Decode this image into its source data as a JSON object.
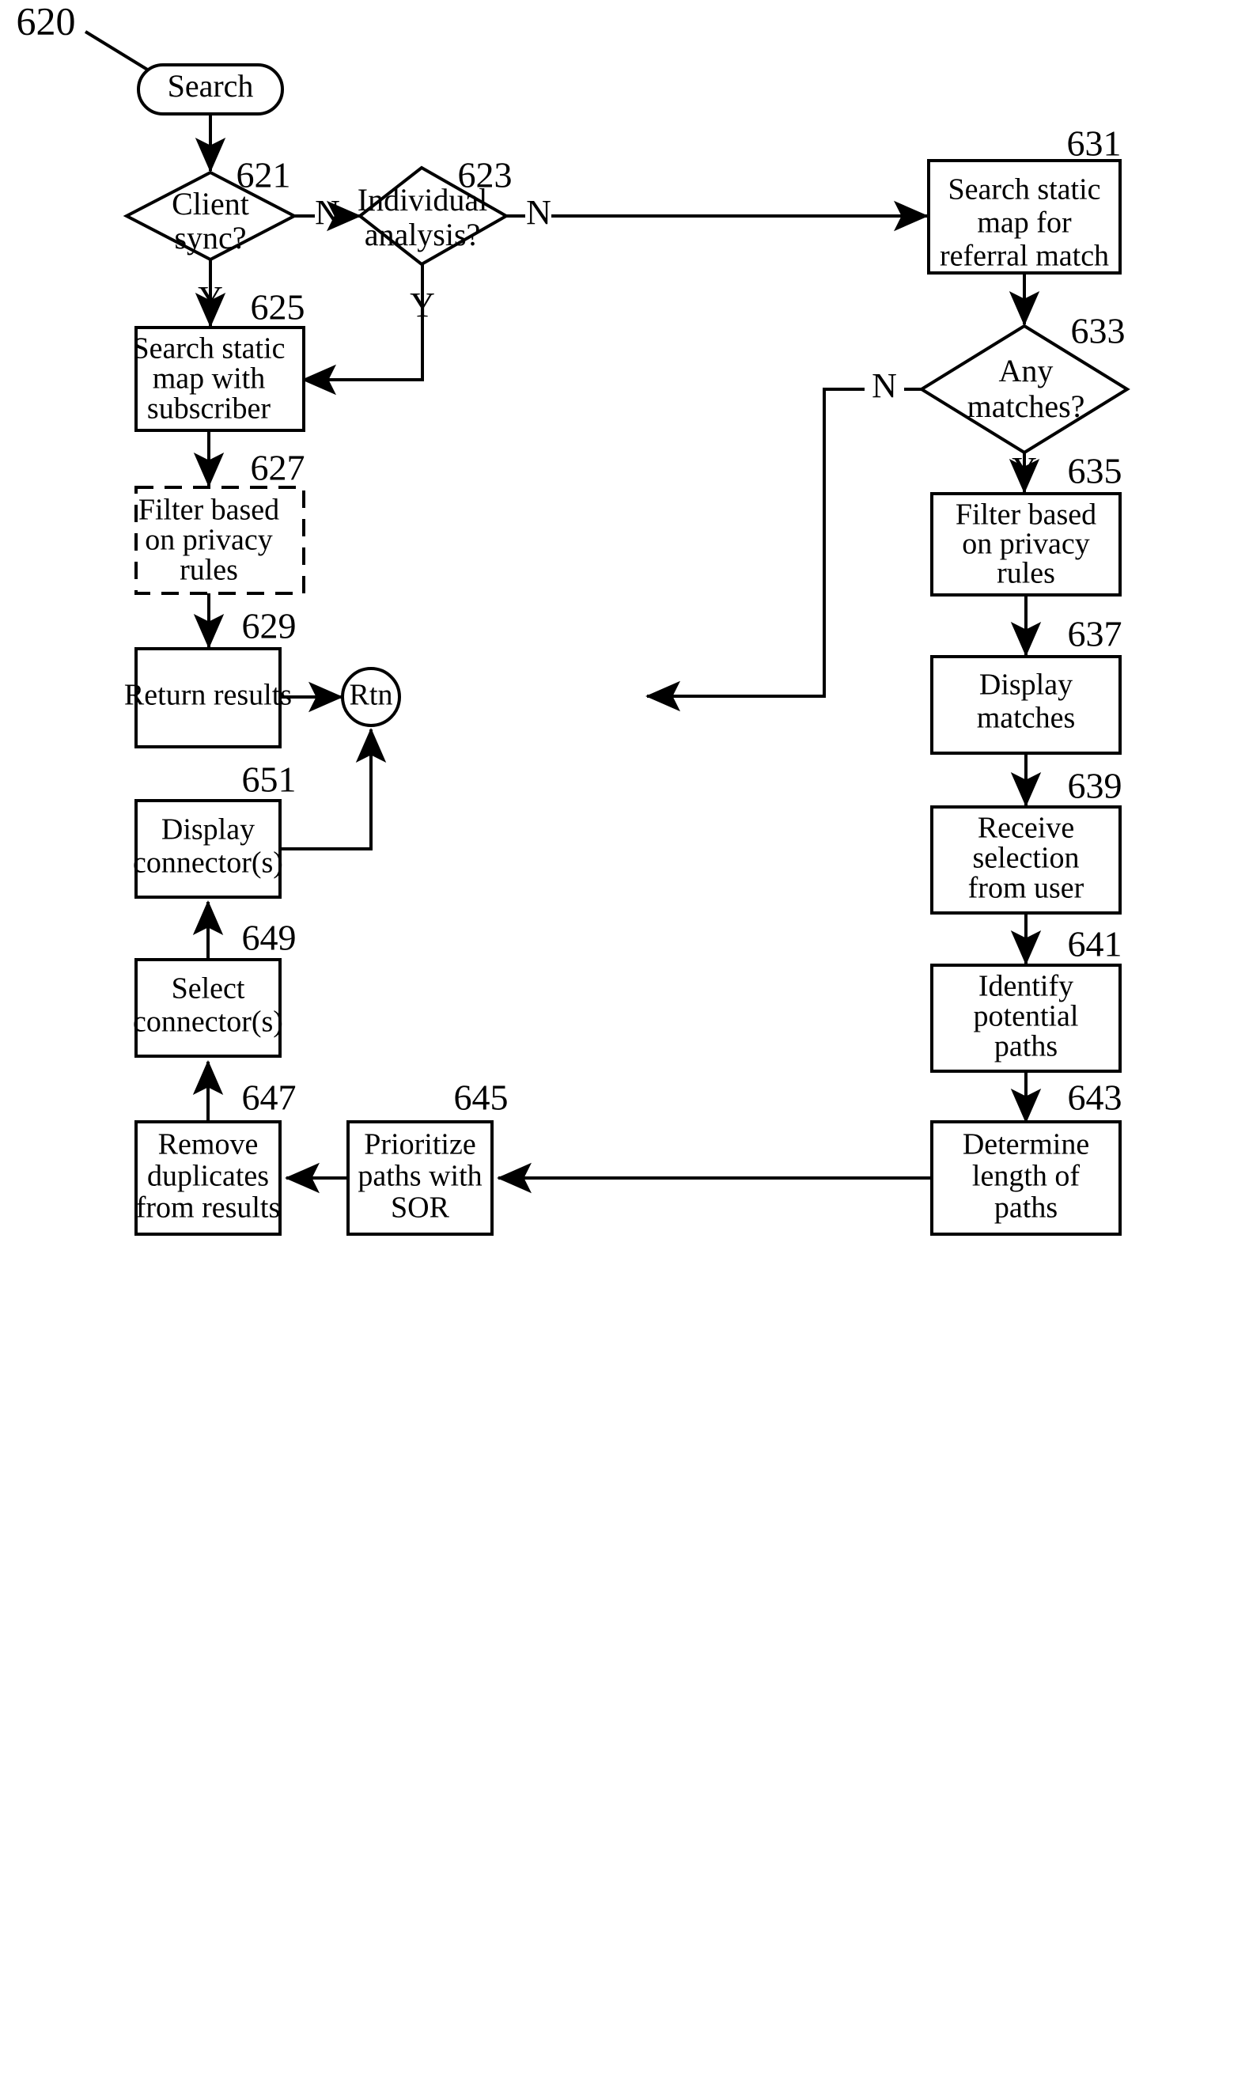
{
  "figure": {
    "label": "620",
    "pointer_icon": "diagonal-arrow-icon"
  },
  "terminal": {
    "label": "Search"
  },
  "connector_node": {
    "label": "Rtn"
  },
  "branch_labels": {
    "no": "N",
    "yes": "Y"
  },
  "nodes": [
    {
      "ref": "621",
      "text_lines": [
        "Client",
        "sync?"
      ],
      "shape": "diamond"
    },
    {
      "ref": "623",
      "text_lines": [
        "Individual",
        "analysis?"
      ],
      "shape": "diamond"
    },
    {
      "ref": "631",
      "text_lines": [
        "Search static",
        "map for",
        "referral match"
      ],
      "shape": "rect"
    },
    {
      "ref": "625",
      "text_lines": [
        "Search static",
        "map with",
        "subscriber"
      ],
      "shape": "rect"
    },
    {
      "ref": "633",
      "text_lines": [
        "Any",
        "matches?"
      ],
      "shape": "diamond"
    },
    {
      "ref": "627",
      "text_lines": [
        "Filter based",
        "on privacy",
        "rules"
      ],
      "shape": "rect-dashed"
    },
    {
      "ref": "635",
      "text_lines": [
        "Filter based",
        "on privacy",
        "rules"
      ],
      "shape": "rect"
    },
    {
      "ref": "629",
      "text_lines": [
        "Return results"
      ],
      "shape": "rect"
    },
    {
      "ref": "637",
      "text_lines": [
        "Display",
        "matches"
      ],
      "shape": "rect"
    },
    {
      "ref": "651",
      "text_lines": [
        "Display",
        "connector(s)"
      ],
      "shape": "rect"
    },
    {
      "ref": "639",
      "text_lines": [
        "Receive",
        "selection",
        "from user"
      ],
      "shape": "rect"
    },
    {
      "ref": "649",
      "text_lines": [
        "Select",
        "connector(s)"
      ],
      "shape": "rect"
    },
    {
      "ref": "641",
      "text_lines": [
        "Identify",
        "potential",
        "paths"
      ],
      "shape": "rect"
    },
    {
      "ref": "647",
      "text_lines": [
        "Remove",
        "duplicates",
        "from results"
      ],
      "shape": "rect"
    },
    {
      "ref": "645",
      "text_lines": [
        "Prioritize",
        "paths with",
        "SOR"
      ],
      "shape": "rect"
    },
    {
      "ref": "643",
      "text_lines": [
        "Determine",
        "length of",
        "paths"
      ],
      "shape": "rect"
    }
  ],
  "colors": {
    "ink": "#000000",
    "paper": "#ffffff"
  }
}
